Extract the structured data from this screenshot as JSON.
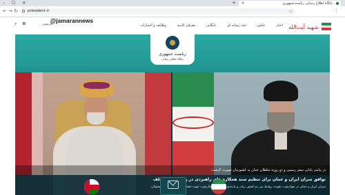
{
  "browser": {
    "tab_title": "پایگاه اطلاع رسانی ریاست‌جمهوری",
    "url": "president.ir",
    "new_tab_symbol": "+",
    "window_controls": "– ☐ ✕"
  },
  "header": {
    "watermark": "@jamarannews",
    "language": "فارسی",
    "nav": [
      "اخبار",
      "عکس",
      "چند رسانه ای",
      "بایگانی",
      "معرفی کابینه",
      "وظایف و اختیارات"
    ],
    "logo_text": "شهید آیت‌الله",
    "emblem_title": "ریاست جمهوری",
    "emblem_sub": "پایگاه اطلاع رسانی"
  },
  "article": {
    "caption": "در پیامی پایانی سفر رسمی و دو روزه سلطان عمان به کشورمان صورت گرفت؛",
    "headline": "توافق سران ایران و عمان برای تنظیم سند همکاری‌های راهبردی در زمینه‌های مختلف",
    "lead": "سران ایران و عمان در چهارچوب تقویت روابط بین دو کشور برادر و پایبندی به اصول و چارچوب جهت حفظ و استمرار آن از مسئولان"
  },
  "colors": {
    "teal": "#2aaaa2",
    "iran_green": "#2b8a4e",
    "iran_red": "#d23c3c",
    "oman_red": "#c8102e"
  }
}
